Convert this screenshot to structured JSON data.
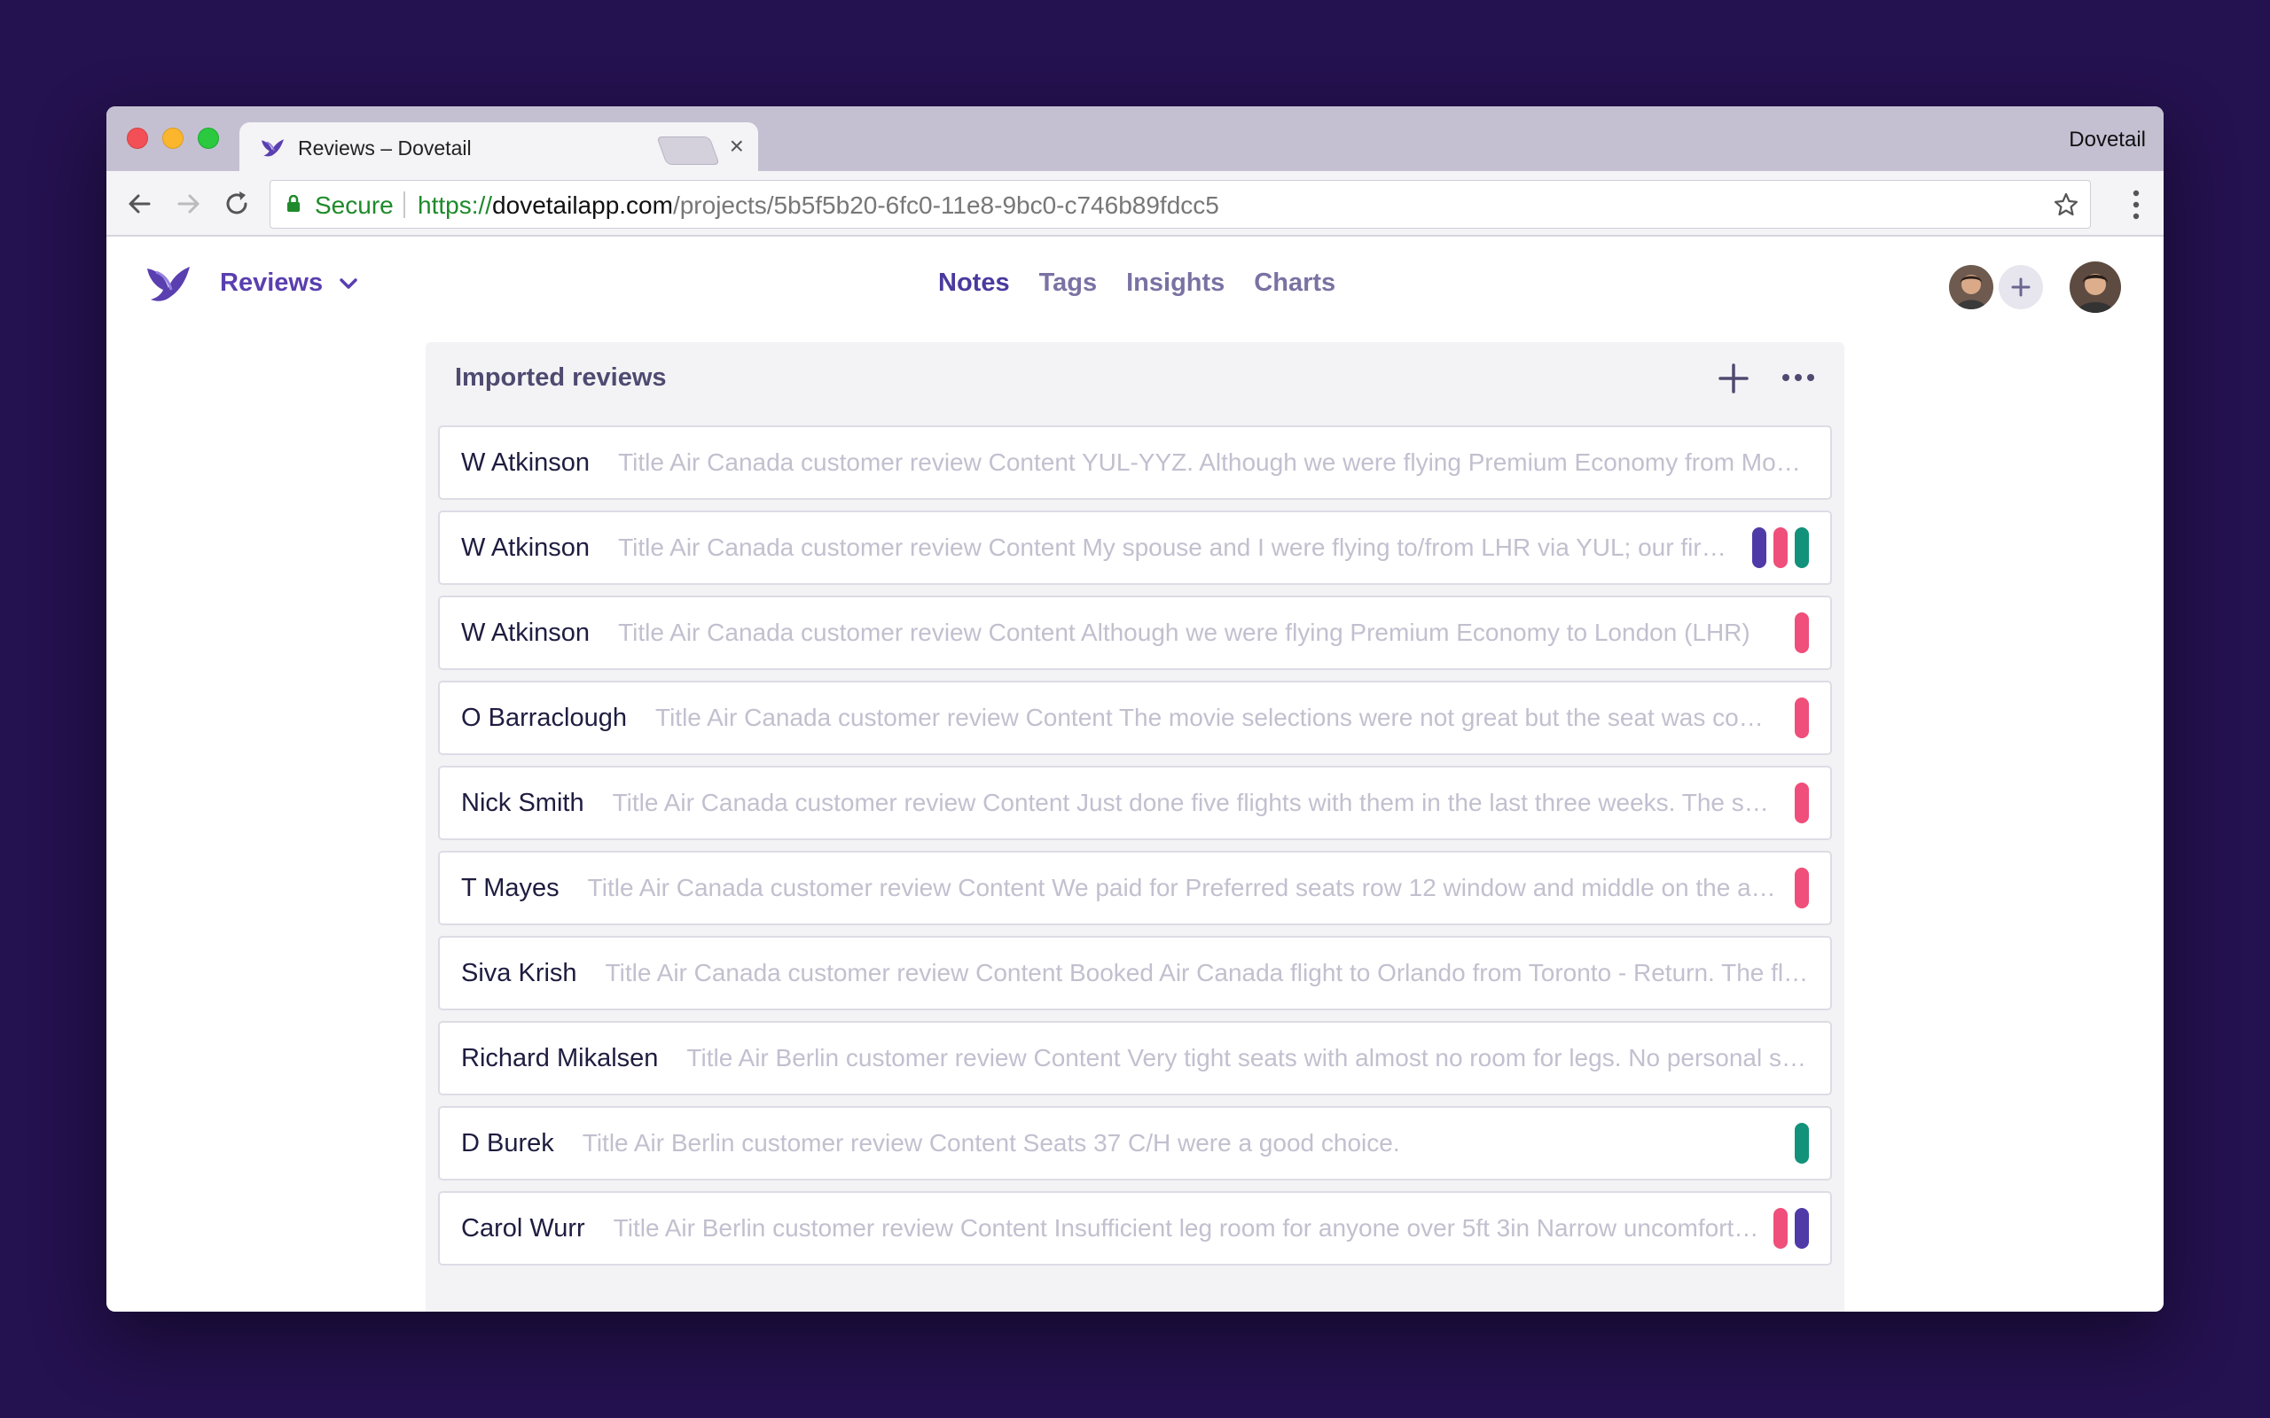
{
  "browser": {
    "tab_title": "Reviews – Dovetail",
    "profile_name": "Dovetail",
    "secure_label": "Secure",
    "url_scheme": "https://",
    "url_host": "dovetailapp.com",
    "url_path": "/projects/5b5f5b20-6fc0-11e8-9bc0-c746b89fdcc5"
  },
  "app": {
    "project_name": "Reviews",
    "nav": [
      {
        "label": "Notes",
        "active": true
      },
      {
        "label": "Tags",
        "active": false
      },
      {
        "label": "Insights",
        "active": false
      },
      {
        "label": "Charts",
        "active": false
      }
    ]
  },
  "panel": {
    "title": "Imported reviews",
    "reviews": [
      {
        "author": "W Atkinson",
        "preview": "Title Air Canada customer review Content YUL-YYZ. Although we were flying Premium Economy from Montreal to Toronto",
        "tags": []
      },
      {
        "author": "W Atkinson",
        "preview": "Title Air Canada customer review Content My spouse and I were flying to/from LHR via YUL; our first flight",
        "tags": [
          "purple",
          "pink",
          "teal"
        ]
      },
      {
        "author": "W Atkinson",
        "preview": "Title Air Canada customer review Content Although we were flying Premium Economy to London (LHR)",
        "tags": [
          "pink"
        ]
      },
      {
        "author": "O Barraclough",
        "preview": "Title Air Canada customer review Content The movie selections were not great but the seat was comfortable",
        "tags": [
          "pink"
        ]
      },
      {
        "author": "Nick Smith",
        "preview": "Title Air Canada customer review Content Just done five flights with them in the last three weeks. The service",
        "tags": [
          "pink"
        ]
      },
      {
        "author": "T Mayes",
        "preview": "Title Air Canada customer review Content We paid for Preferred seats row 12 window and middle on the aircraft",
        "tags": [
          "pink"
        ]
      },
      {
        "author": "Siva Krish",
        "preview": "Title Air Canada customer review Content Booked Air Canada flight to Orlando from Toronto - Return. The flight",
        "tags": []
      },
      {
        "author": "Richard Mikalsen",
        "preview": "Title Air Berlin customer review Content Very tight seats with almost no room for legs. No personal screens",
        "tags": []
      },
      {
        "author": "D Burek",
        "preview": "Title Air Berlin customer review Content Seats 37 C/H were a good choice.",
        "tags": [
          "teal"
        ]
      },
      {
        "author": "Carol Wurr",
        "preview": "Title Air Berlin customer review Content Insufficient leg room for anyone over 5ft 3in Narrow uncomfortable seats",
        "tags": [
          "pink",
          "purple"
        ]
      }
    ]
  },
  "colors": {
    "purple": "#4f3aa8",
    "pink": "#ef4f7a",
    "teal": "#12927a",
    "brand": "#5a3fb0"
  },
  "icons": [
    "bird-logo-icon",
    "close-icon",
    "back-arrow-icon",
    "forward-arrow-icon",
    "reload-icon",
    "lock-icon",
    "star-icon",
    "kebab-menu-icon",
    "chevron-down-icon",
    "plus-icon",
    "more-dots-icon"
  ]
}
